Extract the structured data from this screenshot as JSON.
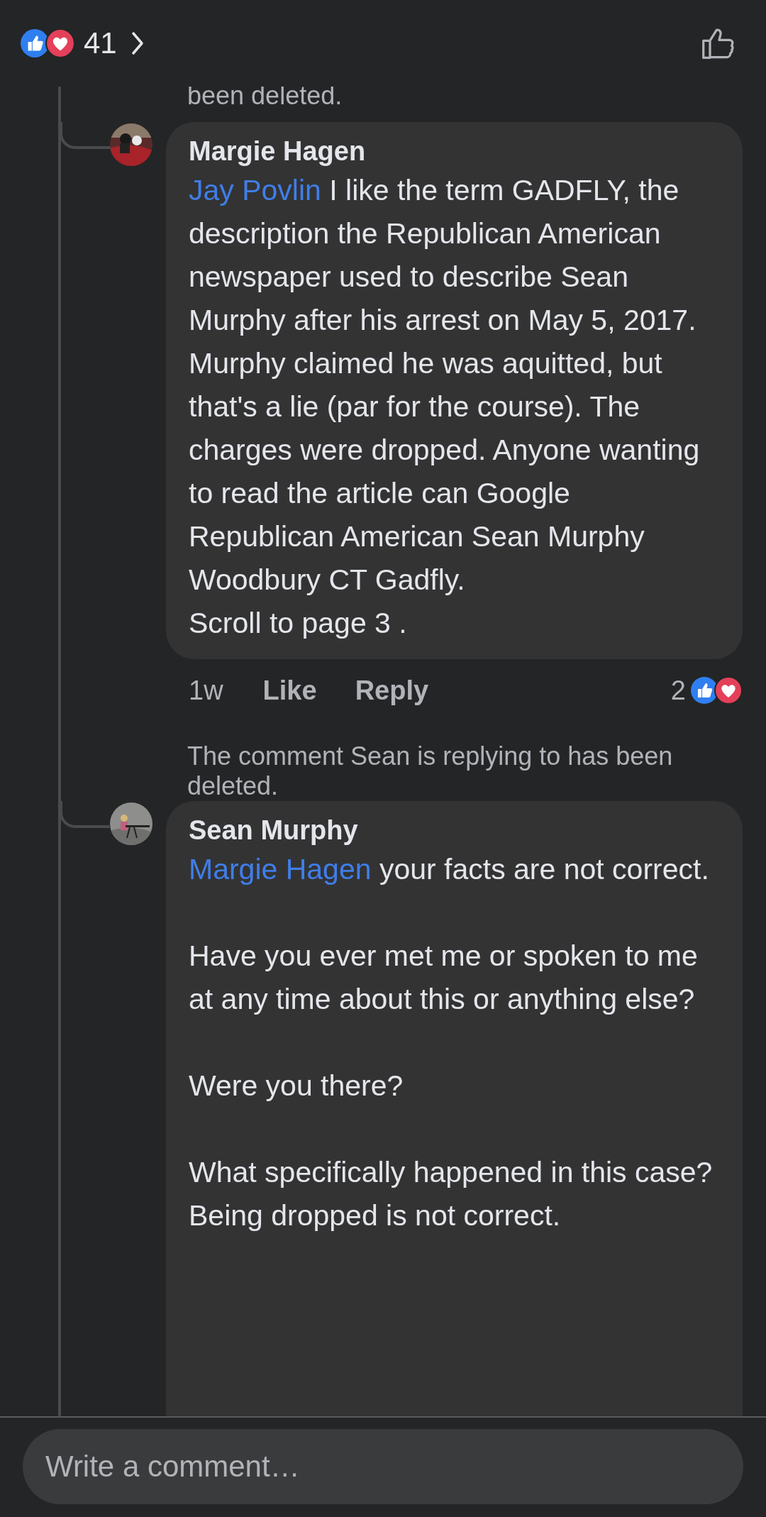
{
  "header": {
    "reaction_count": "41"
  },
  "previous_note_tail": "been deleted.",
  "comments": [
    {
      "author": "Margie Hagen",
      "mention": "Jay Povlin",
      "paragraphs": [
        "I like the term GADFLY, the description the Republican American newspaper used to describe Sean Murphy after his arrest on May 5, 2017.  Murphy claimed he was aquitted, but that's a lie (par for the course). The charges were dropped. Anyone wanting to read the article can Google Republican American Sean Murphy Woodbury CT Gadfly.\nScroll to page 3 ."
      ],
      "time": "1w",
      "like": "Like",
      "reply": "Reply",
      "reaction_count": "2"
    },
    {
      "reply_note": "The comment Sean is replying to has been deleted.",
      "author": "Sean Murphy",
      "mention": "Margie Hagen",
      "paragraphs": [
        "your facts are not correct.",
        "Have you ever met me or spoken to me at any time about this or anything else?",
        "Were you there?",
        "What specifically happened in this case? Being dropped is not correct."
      ]
    }
  ],
  "composer": {
    "placeholder": "Write a comment…"
  }
}
